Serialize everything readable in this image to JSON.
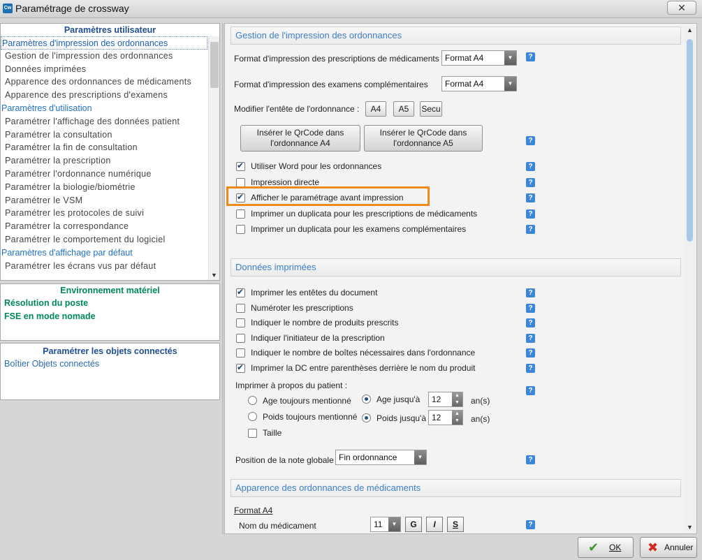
{
  "window": {
    "title": "Paramétrage de crossway",
    "icon_label": "Cw",
    "close_label": "✕"
  },
  "left": {
    "user_params": {
      "header": "Paramètres utilisateur",
      "items": [
        {
          "label": "Paramètres d'impression des ordonnances",
          "kind": "sel"
        },
        {
          "label": "Gestion de l'impression des ordonnances",
          "kind": "sub"
        },
        {
          "label": "Données imprimées",
          "kind": "sub"
        },
        {
          "label": "Apparence des ordonnances de médicaments",
          "kind": "sub"
        },
        {
          "label": "Apparence des prescriptions d'examens",
          "kind": "sub"
        },
        {
          "label": "Paramètres d'utilisation",
          "kind": "cat"
        },
        {
          "label": "Paramétrer l'affichage des données patient",
          "kind": "sub"
        },
        {
          "label": "Paramétrer la consultation",
          "kind": "sub"
        },
        {
          "label": "Paramétrer la fin de consultation",
          "kind": "sub"
        },
        {
          "label": "Paramétrer la prescription",
          "kind": "sub"
        },
        {
          "label": "Paramétrer l'ordonnance numérique",
          "kind": "sub"
        },
        {
          "label": "Paramétrer la biologie/biométrie",
          "kind": "sub"
        },
        {
          "label": "Paramétrer le VSM",
          "kind": "sub"
        },
        {
          "label": "Paramétrer les protocoles de suivi",
          "kind": "sub"
        },
        {
          "label": "Paramétrer la correspondance",
          "kind": "sub"
        },
        {
          "label": "Paramétrer le comportement du logiciel",
          "kind": "sub"
        },
        {
          "label": "Paramètres d'affichage par défaut",
          "kind": "cat"
        },
        {
          "label": "Paramétrer les écrans vus par défaut",
          "kind": "sub"
        }
      ]
    },
    "hardware": {
      "header": "Environnement matériel",
      "items": [
        "Résolution du poste",
        "FSE en mode nomade"
      ]
    },
    "objects": {
      "header": "Paramétrer les objets connectés",
      "items": [
        "Boîtier Objets connectés"
      ]
    }
  },
  "right": {
    "section1": {
      "title": "Gestion de l'impression des ordonnances",
      "format_meds_label": "Format d'impression des prescriptions de médicaments",
      "format_meds_value": "Format A4",
      "format_exams_label": "Format d'impression des examens complémentaires",
      "format_exams_value": "Format A4",
      "header_label": "Modifier l'entête de l'ordonnance :",
      "header_buttons": [
        "A4",
        "A5",
        "Secu"
      ],
      "qr_a4_line1": "Insérer le QrCode dans",
      "qr_a4_line2": "l'ordonnance A4",
      "qr_a5_line1": "Insérer le QrCode dans",
      "qr_a5_line2": "l'ordonnance A5",
      "checks": [
        {
          "label": "Utiliser Word pour les ordonnances",
          "checked": true
        },
        {
          "label": "Impression directe",
          "checked": false
        },
        {
          "label": "Afficher le paramétrage avant impression",
          "checked": true
        },
        {
          "label": "Imprimer un duplicata pour les prescriptions de médicaments",
          "checked": false
        },
        {
          "label": "Imprimer un duplicata pour les examens complémentaires",
          "checked": false
        }
      ]
    },
    "section2": {
      "title": "Données imprimées",
      "checks": [
        {
          "label": "Imprimer les entêtes du document",
          "checked": true
        },
        {
          "label": "Numéroter les prescriptions",
          "checked": false
        },
        {
          "label": "Indiquer le nombre de produits prescrits",
          "checked": false
        },
        {
          "label": "Indiquer l'initiateur de la prescription",
          "checked": false
        },
        {
          "label": "Indiquer le nombre de boîtes nécessaires dans l'ordonnance",
          "checked": false
        },
        {
          "label": "Imprimer la DC entre parenthèses derrière le nom du produit",
          "checked": true
        }
      ],
      "patient_label": "Imprimer à propos du patient :",
      "age_always": "Age toujours mentionné",
      "age_until": "Age jusqu'à",
      "age_value": "12",
      "weight_always": "Poids toujours mentionné",
      "weight_until": "Poids jusqu'à",
      "weight_value": "12",
      "unit": "an(s)",
      "taille": "Taille",
      "note_label": "Position de la note globale",
      "note_value": "Fin ordonnance"
    },
    "section3": {
      "title": "Apparence des ordonnances de médicaments",
      "format_label": "Format A4",
      "drug_name_label": "Nom du médicament",
      "font_size": "11",
      "bold": "G",
      "italic": "I",
      "underline": "S"
    },
    "help_glyph": "?"
  },
  "footer": {
    "ok_label": "OK",
    "cancel_label": "Annuler"
  },
  "colors": {
    "highlight": "#f08a1c",
    "accent": "#3d7fc4",
    "green": "#00875a"
  }
}
